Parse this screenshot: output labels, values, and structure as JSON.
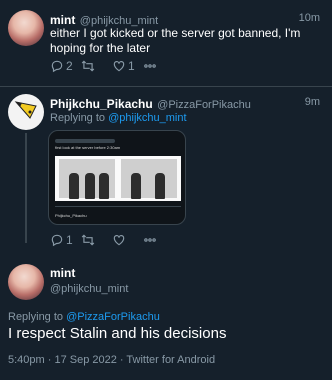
{
  "tweets": [
    {
      "name": "mint",
      "handle": "@phijkchu_mint",
      "time": "10m",
      "text": "either I got kicked or the server got banned, I'm hoping for the later",
      "replies": "2",
      "retweets": "",
      "likes": "1"
    },
    {
      "name": "Phijkchu_Pikachu",
      "handle": "@PizzaForPikachu",
      "time": "9m",
      "replying_label": "Replying to",
      "replying_to": "@phijkchu_mint",
      "media_caption": "first look at the server before 2:30am",
      "media_user": "Phijkchu_Pikachu",
      "replies": "1",
      "retweets": "",
      "likes": ""
    }
  ],
  "main_tweet": {
    "name": "mint",
    "handle": "@phijkchu_mint",
    "replying_label": "Replying to",
    "replying_to": "@PizzaForPikachu",
    "text": "I respect Stalin and his decisions",
    "meta": "5:40pm · 17 Sep 2022 · Twitter for Android"
  },
  "colors": {
    "background": "#15202b",
    "accent": "#1d9bf0",
    "muted": "#8899a6"
  },
  "icons": [
    "reply-icon",
    "retweet-icon",
    "like-icon",
    "more-icon"
  ]
}
